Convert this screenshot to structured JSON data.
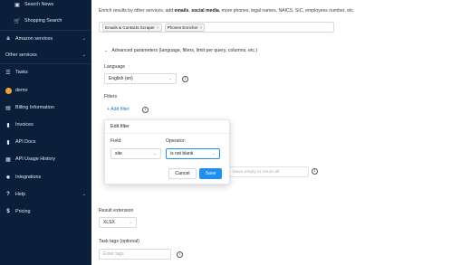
{
  "sidebar": {
    "items": [
      {
        "label": "Search News",
        "icon": "news-icon"
      },
      {
        "label": "Shopping Search",
        "icon": "shopping-icon"
      },
      {
        "label": "Amazon services",
        "icon": "amazon-icon"
      },
      {
        "label": "Other services",
        "icon": ""
      },
      {
        "label": "Tasks",
        "icon": "list-icon"
      },
      {
        "label": "demo",
        "icon": "avatar"
      },
      {
        "label": "Billing Information",
        "icon": "card-icon"
      },
      {
        "label": "Invoices",
        "icon": "invoice-icon"
      },
      {
        "label": "API Docs",
        "icon": "doc-icon"
      },
      {
        "label": "API Usage History",
        "icon": "history-icon"
      },
      {
        "label": "Integrations",
        "icon": "integrations-icon"
      },
      {
        "label": "Help",
        "icon": "help-icon"
      },
      {
        "label": "Pricing",
        "icon": "dollar-icon"
      }
    ]
  },
  "main": {
    "description_prefix": "Enrich results by other services, add ",
    "description_bold1": "emails",
    "description_sep": ", ",
    "description_bold2": "social media",
    "description_suffix": ", more phones, legal names, NAICS, SIC, employees number, etc.",
    "enrichment_tags": [
      "Emails & Contacts Scraper",
      "Phones Enricher"
    ],
    "advanced_label": "Advanced parameters (language, filters, limit per query, columns, etc.)",
    "language_label": "Language",
    "language_value": "English (en)",
    "filters_label": "Filters",
    "add_filter_label": "+ Add filter",
    "limit_placeholder": "leave empty to return all",
    "result_extension_label": "Result extension",
    "result_extension_value": "XLSX",
    "task_tags_label": "Task tags (optional)",
    "task_tags_placeholder": "Enter tags"
  },
  "popup": {
    "title": "Edit filter",
    "field_label": "Field:",
    "field_value": "site",
    "operator_label": "Operator:",
    "operator_value": "is not blank",
    "cancel_label": "Cancel",
    "save_label": "Save"
  },
  "colors": {
    "sidebar_bg": "#0b1f3a",
    "accent": "#1f8ff0",
    "link": "#2f6fd6",
    "avatar": "#f0a23b"
  }
}
